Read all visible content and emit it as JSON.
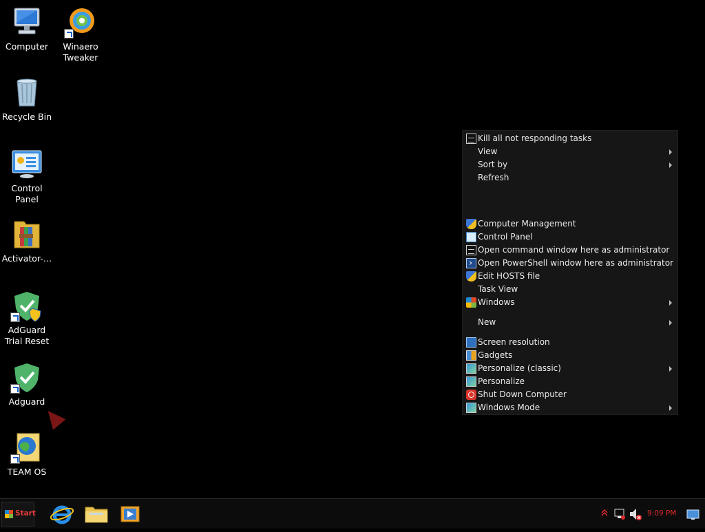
{
  "desktop": {
    "icons": [
      {
        "label": "Computer",
        "icon": "computer-icon"
      },
      {
        "label": "Winaero Tweaker",
        "icon": "winaero-tweaker-icon"
      },
      {
        "label": "Recycle Bin",
        "icon": "recycle-bin-icon"
      },
      {
        "label": "Control Panel",
        "icon": "control-panel-icon"
      },
      {
        "label": "Activator-…",
        "icon": "archive-folder-icon"
      },
      {
        "label": "AdGuard Trial Reset",
        "icon": "adguard-shield-icon"
      },
      {
        "label": "Adguard",
        "icon": "adguard-shield-icon"
      },
      {
        "label": "TEAM OS",
        "icon": "globe-document-icon"
      }
    ]
  },
  "context_menu": {
    "items": [
      {
        "label": "Kill all not responding tasks",
        "icon": "command-window-icon",
        "submenu": false
      },
      {
        "label": "View",
        "icon": "",
        "submenu": true
      },
      {
        "label": "Sort by",
        "icon": "",
        "submenu": true
      },
      {
        "label": "Refresh",
        "icon": "",
        "submenu": false
      },
      {
        "label": "Computer Management",
        "icon": "uac-shield-icon",
        "submenu": false
      },
      {
        "label": "Control Panel",
        "icon": "control-panel-icon",
        "submenu": false
      },
      {
        "label": "Open command window here as administrator",
        "icon": "command-window-icon",
        "submenu": false
      },
      {
        "label": "Open PowerShell window here as administrator",
        "icon": "powershell-icon",
        "submenu": false
      },
      {
        "label": "Edit HOSTS file",
        "icon": "uac-shield-icon",
        "submenu": false
      },
      {
        "label": "Task View",
        "icon": "",
        "submenu": false
      },
      {
        "label": "Windows",
        "icon": "windows-flag-icon",
        "submenu": true
      },
      {
        "label": "New",
        "icon": "",
        "submenu": true
      },
      {
        "label": "Screen resolution",
        "icon": "screen-resolution-icon",
        "submenu": false
      },
      {
        "label": "Gadgets",
        "icon": "gadgets-icon",
        "submenu": false
      },
      {
        "label": "Personalize (classic)",
        "icon": "personalize-icon",
        "submenu": true
      },
      {
        "label": "Personalize",
        "icon": "personalize-icon",
        "submenu": false
      },
      {
        "label": "Shut Down Computer",
        "icon": "shutdown-icon",
        "submenu": false
      },
      {
        "label": "Windows Mode",
        "icon": "personalize-icon",
        "submenu": true
      }
    ]
  },
  "taskbar": {
    "start_label": "Start",
    "pinned": [
      "internet-explorer-icon",
      "file-explorer-icon",
      "media-player-icon"
    ],
    "tray_icons": [
      "show-hidden-icons-chevron-icon",
      "network-icon",
      "volume-muted-icon",
      "show-desktop-icon"
    ],
    "clock": "9:09 PM"
  },
  "colors": {
    "desktop_bg": "#000000",
    "menu_bg": "#161616",
    "menu_text": "#eaeaea",
    "clock_text": "#e12b2b",
    "start_text": "#e43b3b"
  }
}
